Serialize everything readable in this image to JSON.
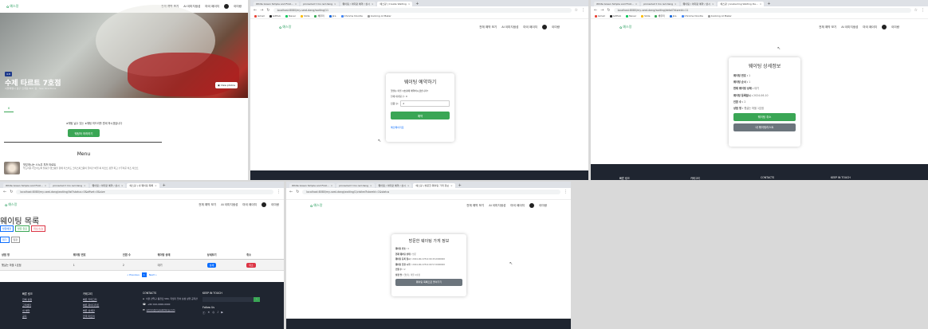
{
  "colors": {
    "brand": "#3aa66b",
    "green_button": "#3aa655",
    "gray_button": "#6c757d",
    "footer": "#1f2530",
    "blue": "#0d6efd",
    "red": "#dc3545"
  },
  "store_page": {
    "nav": {
      "logo": "예스랑",
      "links": [
        "전체 예약 보기",
        "AI 이미지생성",
        "마이 페이지"
      ],
      "user": "이미랑"
    },
    "badge": "4.8",
    "store_name": "수제 타르트 7호점",
    "store_sub": "서울특별시 중구 인계동 Bldr 층 · See directions",
    "view_photos": "View photos",
    "tab_count": "6",
    "waiting_prompt": "★웨팅 날수 있는 ★웨팅 미드리를 원세 하시겠습니다",
    "waiting_button": "웨팅하 하하하기",
    "menu_title": "Menu",
    "menu_item_name": "맛있게시는 스노우 치즈 타르트",
    "menu_item_desc": "부드러운 커스터드와 찰롤한 생크림을 함께 카스터드 크리스피크림이 들어간 비밀 찌 타르트 정말 최고 누두러운 치즈 타르트"
  },
  "reserve_page": {
    "tabs": [
      {
        "label": "White Green Simple and First..."
      },
      {
        "label": "pinnacled t mo red dang"
      },
      {
        "label": "웨이팅 / 이미랑 예약 / 상시"
      },
      {
        "label": "예스랑 | Create Waiting"
      }
    ],
    "url": "localhost:8080/my-seat-dang/waiting/11",
    "bookmarks": [
      "Gmail",
      "GitHub",
      "Naver",
      "Slide",
      "채우리",
      "Jira",
      "Chrome Doodle",
      "booking AI Maker"
    ],
    "nav": {
      "logo": "예스랑",
      "links": [
        "전체 예약 보기",
        "AI 이미지생성",
        "마이 페이지"
      ],
      "user": "이미랑"
    },
    "card_title": "웨이팅 예약하기",
    "store_line": "햇살는 마을 1호점에 예약하시겠습니까?",
    "current_waiting": "현재 대기팀 수: 0",
    "people_label": "인원 수:",
    "people_value": "2",
    "submit": "예약",
    "cancel_link": "메인페이지로"
  },
  "detail_page": {
    "tabs": [
      {
        "label": "White Green Simple and First..."
      },
      {
        "label": "pinnacled t mo red dang"
      },
      {
        "label": "웨이팅 / 이미랑 예약 / 상시"
      },
      {
        "label": "예스랑 | Aceberling Waiting De..."
      }
    ],
    "url": "localhost:8080/my-seat-dang/waiting/detail?storeId=11",
    "bookmarks": [
      "Gmail",
      "GitHub",
      "Naver",
      "Slide",
      "채우리",
      "Jira",
      "Chrome Doodle",
      "booking AI Maker"
    ],
    "nav": {
      "logo": "예스랑",
      "links": [
        "전체 예약 보기",
        "AI 이미지생성",
        "마이 페이지"
      ],
      "user": "이미랑"
    },
    "card_title": "웨이팅 상세정보",
    "fields": [
      {
        "label": "웨이팅 번호 :",
        "value": "1"
      },
      {
        "label": "웨이팅 순서 :",
        "value": "1"
      },
      {
        "label": "현재 웨이팅 상태 :",
        "value": "대기"
      },
      {
        "label": "웨이팅 등록일시 :",
        "value": "2024-06-10"
      },
      {
        "label": "인원 수 :",
        "value": "2"
      },
      {
        "label": "상점 명 :",
        "value": "햇살는 마을 1호점"
      }
    ],
    "btn_cancel": "웨이팅 취소",
    "btn_list": "내 웨이팅리스트",
    "footer_cols": [
      "빠른 링크",
      "카테고리",
      "CONTACTS",
      "KEEP IN TOUCH"
    ]
  },
  "list_page": {
    "tabs": [
      {
        "label": "White Green Simple and First..."
      },
      {
        "label": "pinnacled t mo red dang"
      },
      {
        "label": "웨이팅 / 이미랑 예약 / 상시"
      },
      {
        "label": "예스랑 | 내 웨이팅 목록"
      }
    ],
    "url": "localhost:8080/my-seat-dang/waiting/list?status=0&offset=0&size",
    "nav": {
      "logo": "예스랑",
      "links": [
        "전체 예약 보기",
        "AI 이미지생성",
        "마이 페이지"
      ],
      "user": "이미랑"
    },
    "title": "웨이팅 목록",
    "filter_tabs": [
      "방문예정",
      "방문 완료",
      "취소/노쇼"
    ],
    "sub_tabs": [
      "대기",
      "입장"
    ],
    "columns": [
      "상점 명",
      "웨이팅 번호",
      "인원 수",
      "웨이팅 상태",
      "상세보기",
      "취소"
    ],
    "rows": [
      {
        "store": "햇살는 마을 1호점",
        "number": "1",
        "people": "2",
        "status": "대기",
        "detail": "상세",
        "cancel": "취소"
      }
    ],
    "pagination": {
      "prev": "« Previous",
      "page": "1",
      "next": "Next »"
    },
    "footer": {
      "quick_title": "빠른 링크",
      "quick_items": [
        "전체 상점",
        "고객센터",
        "내 예약",
        "공지"
      ],
      "cat_title": "카테고리",
      "cat_items": [
        "빠른 카테고리",
        "빠른 화이디저트",
        "빠른 상세만",
        "전국 마트리"
      ],
      "contact_title": "CONTACTS",
      "address": "서울 관악구 봉천로 584, 학생기 업서 삼성 상행 공학관",
      "phone": "+82 010-0000-0000",
      "email": "admin@myseatdang.com",
      "keep_title": "KEEP IN TOUCH",
      "follow": "Follow Us"
    }
  },
  "visited_page": {
    "tabs": [
      {
        "label": "White Green Simple and First..."
      },
      {
        "label": "pinnacled t mo red dang"
      },
      {
        "label": "웨이팅 / 이미랑 예약 / 상시"
      },
      {
        "label": "예스랑 | 방문한 웨이팅 가게 정보"
      }
    ],
    "url": "localhost:8080/my-seat-dang/waiting/1/visited?storeId=1&status",
    "nav": {
      "logo": "예스랑",
      "links": [
        "전체 예약 보기",
        "AI 이미지생성",
        "마이 페이지"
      ],
      "user": "이미랑"
    },
    "card_title": "방문한 웨이팅 가게 정보",
    "fields": [
      {
        "label": "웨이팅 번호 :",
        "value": "1"
      },
      {
        "label": "현재 웨이팅 상태 :",
        "value": "방문"
      },
      {
        "label": "웨이팅 등록 일시 :",
        "value": "2024-06-10T14:00:45.0000000"
      },
      {
        "label": "웨이팅 입장 시각 :",
        "value": "2024-06-10T14:00:57.0000000"
      },
      {
        "label": "인원 수 :",
        "value": "2"
      },
      {
        "label": "상점 명 :",
        "value": "햇살는 마을 1호점"
      }
    ],
    "btn_list": "웨이팅 목록으로 돌아가기"
  }
}
